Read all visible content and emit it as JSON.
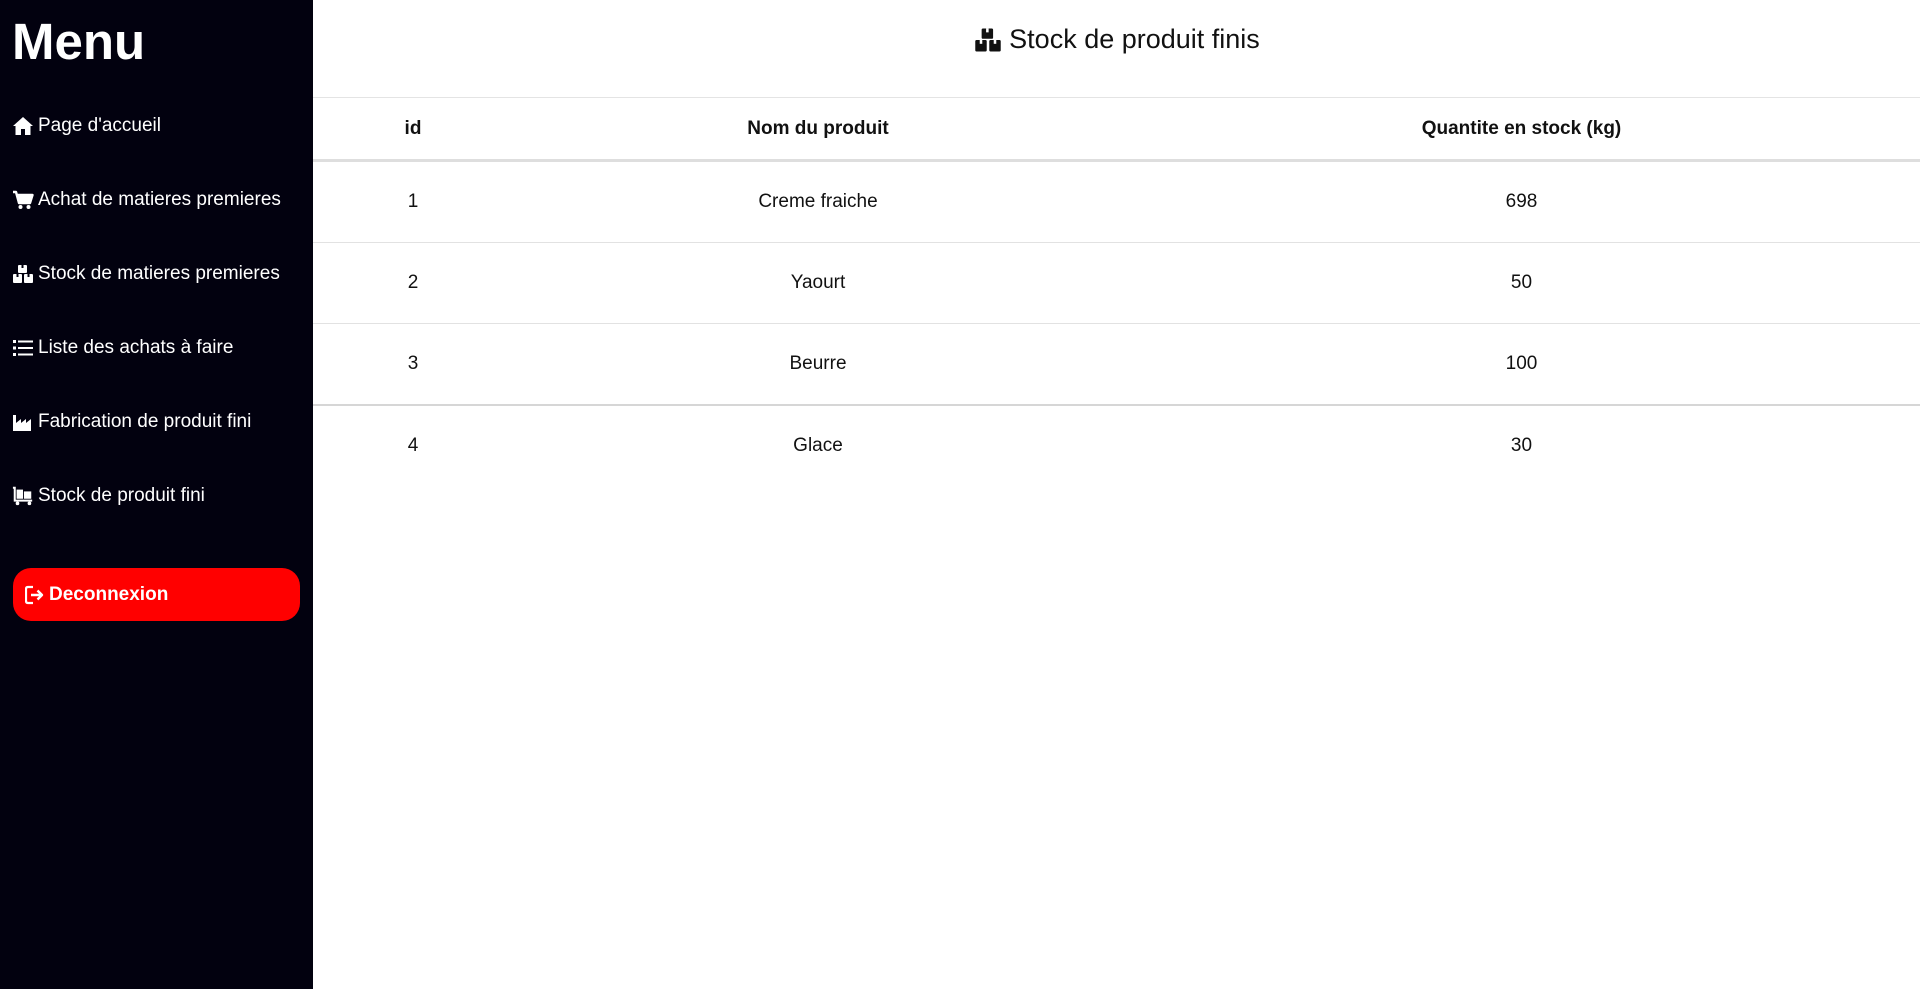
{
  "sidebar": {
    "title": "Menu",
    "items": [
      {
        "label": "Page d'accueil",
        "icon": "home-icon"
      },
      {
        "label": "Achat de matieres premieres",
        "icon": "cart-icon"
      },
      {
        "label": "Stock de matieres premieres",
        "icon": "boxes-icon"
      },
      {
        "label": "Liste des achats à faire",
        "icon": "list-icon"
      },
      {
        "label": "Fabrication de produit fini",
        "icon": "industry-icon"
      },
      {
        "label": "Stock de produit fini",
        "icon": "dolly-icon"
      }
    ],
    "logout": {
      "label": "Deconnexion",
      "icon": "sign-out-icon"
    }
  },
  "main": {
    "title": "Stock de produit finis",
    "title_icon": "boxes-icon",
    "table": {
      "headers": [
        "id",
        "Nom du produit",
        "Quantite en stock (kg)"
      ],
      "rows": [
        {
          "id": "1",
          "name": "Creme fraiche",
          "qty": "698"
        },
        {
          "id": "2",
          "name": "Yaourt",
          "qty": "50"
        },
        {
          "id": "3",
          "name": "Beurre",
          "qty": "100"
        },
        {
          "id": "4",
          "name": "Glace",
          "qty": "30"
        }
      ]
    }
  },
  "colors": {
    "sidebar_bg": "#02010f",
    "logout_bg": "#ff0000",
    "text": "#111111"
  }
}
